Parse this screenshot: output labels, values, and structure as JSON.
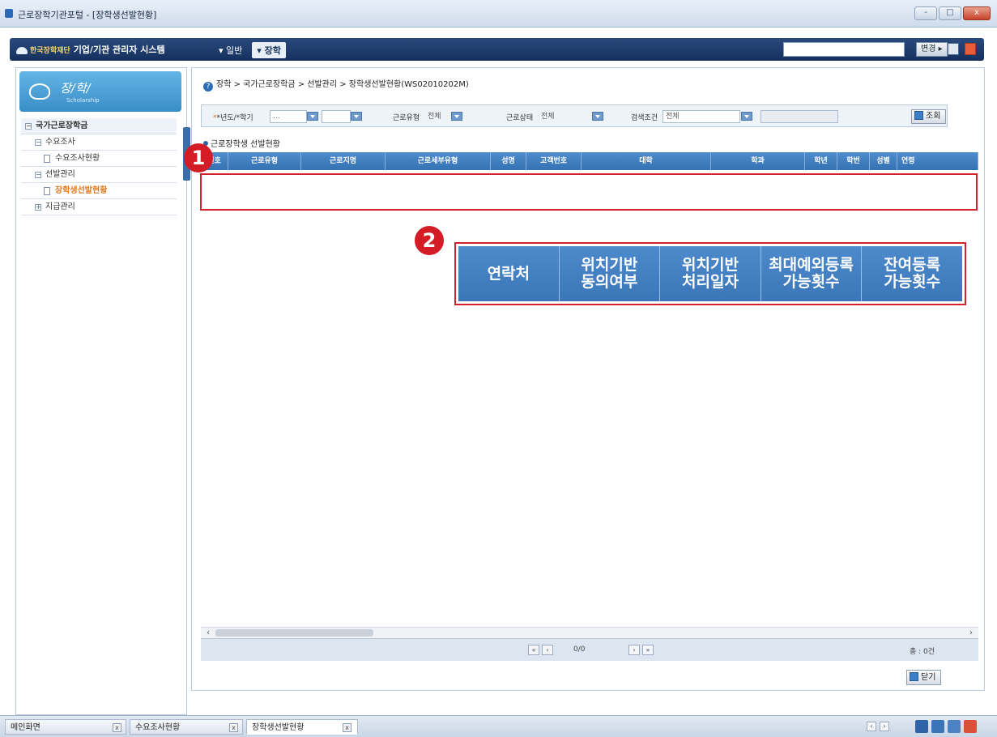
{
  "window": {
    "title": "근로장학기관포털 - [장학생선발현황]",
    "controls": [
      "-",
      "□",
      "x"
    ]
  },
  "appbar": {
    "brand": "한국장학재단",
    "system_name": "기업/기관 관리자 시스템",
    "menu": [
      {
        "label": "▾ 일반",
        "active": false
      },
      {
        "label": "▾ 장학",
        "active": true
      }
    ],
    "search_button": "변경 ▸"
  },
  "sidebar": {
    "title": "장/학/",
    "subtitle": "Scholarship",
    "tree": [
      {
        "label": "국가근로장학금",
        "level": 0,
        "toggle": "−"
      },
      {
        "label": "수요조사",
        "level": 1,
        "toggle": "−"
      },
      {
        "label": "수요조사현황",
        "level": 2
      },
      {
        "label": "선발관리",
        "level": 1,
        "toggle": "−"
      },
      {
        "label": "장학생선발현황",
        "level": 2,
        "current": true
      },
      {
        "label": "지급관리",
        "level": 1,
        "toggle": "+"
      }
    ]
  },
  "main": {
    "breadcrumb": "장학 > 국가근로장학금 > 선발관리 > 장학생선발현황(WS02010202M)",
    "search": {
      "year_term_label": "*년도/*학기",
      "year_value": "...",
      "work_type_label": "근로유형",
      "work_type_value": "전체",
      "work_status_label": "근로상태",
      "work_status_value": "전체",
      "search_cond_label": "검색조건",
      "search_cond_value": "전체",
      "query_button": "조회"
    },
    "grid_title": "근로장학생 선발현황",
    "columns": [
      "번호",
      "근로유형",
      "근로지명",
      "근로세부유형",
      "성명",
      "고객번호",
      "대학",
      "학과",
      "학년",
      "학번",
      "성별",
      "연령"
    ],
    "callout_numbers": [
      "1",
      "2"
    ],
    "zoom_columns": [
      [
        "연락처"
      ],
      [
        "위치기반",
        "동의여부"
      ],
      [
        "위치기반",
        "처리일자"
      ],
      [
        "최대예외등록",
        "가능횟수"
      ],
      [
        "잔여등록",
        "가능횟수"
      ]
    ],
    "pager": {
      "first": "«",
      "prev": "‹",
      "page_text": "0/0",
      "next": "›",
      "last": "»",
      "total": "총 : 0건"
    },
    "scroll": {
      "left": "‹",
      "right": "›"
    },
    "close_button": "닫기"
  },
  "taskbar": {
    "tabs": [
      {
        "label": "메인화면",
        "active": false
      },
      {
        "label": "수요조사현황",
        "active": false
      },
      {
        "label": "장학생선발현황",
        "active": true
      }
    ],
    "nav": [
      "‹",
      "›"
    ]
  },
  "colors": {
    "grid_header": "#3f7cc0",
    "callout_red": "#d4202a",
    "appbar": "#1c3a6b"
  }
}
